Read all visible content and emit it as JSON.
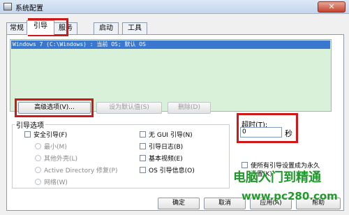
{
  "window": {
    "title": "系统配置",
    "close_glyph": "✕"
  },
  "tabs": [
    {
      "label": "常规"
    },
    {
      "label": "引导"
    },
    {
      "label": "服务"
    },
    {
      "label": "启动"
    },
    {
      "label": "工具"
    }
  ],
  "os_list": {
    "items": [
      "Windows 7 (C:\\Windows) : 当前 OS; 默认 OS"
    ]
  },
  "list_buttons": {
    "advanced": "高级选项(V)...",
    "set_default": "设为默认值(S)",
    "delete": "删除(D)"
  },
  "boot_options": {
    "group_label": "引导选项",
    "safe_boot": "安全引导(F)",
    "minimal": "最小(M)",
    "alternate_shell": "其他外壳(L)",
    "active_directory": "Active Directory 修复(P)",
    "network": "网络(W)",
    "no_gui": "无 GUI 引导(N)",
    "boot_log": "引导日志(B)",
    "base_video": "基本视频(E)",
    "os_info": "OS 引导信息(O)"
  },
  "timeout": {
    "label": "超时(T):",
    "value": "0",
    "unit": "秒"
  },
  "permanent": {
    "label_line1": "使所有引导设置成为永久",
    "label_line2": "设置(K)"
  },
  "footer": {
    "ok": "确定",
    "cancel": "取消",
    "apply": "应用(A)",
    "help": "帮助"
  },
  "watermark": {
    "cn": "电脑入门到精通",
    "url": "www.pc280.com"
  },
  "colors": {
    "highlight_box": "#d01818",
    "selection": "#3a78d0",
    "list_bg": "#d9f0d9",
    "watermark": "#1f9a2a"
  }
}
